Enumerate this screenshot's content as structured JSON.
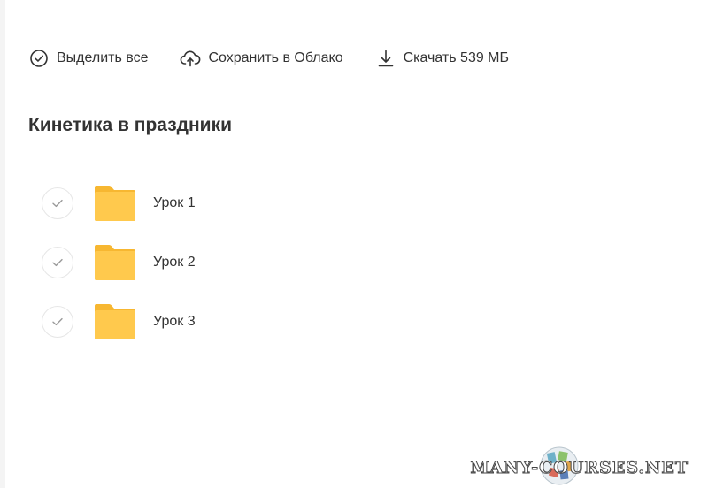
{
  "toolbar": {
    "select_all_label": "Выделить все",
    "save_label": "Сохранить в Облако",
    "download_label": "Скачать 539 МБ"
  },
  "folder": {
    "title": "Кинетика в праздники",
    "items": [
      {
        "name": "Урок 1"
      },
      {
        "name": "Урок 2"
      },
      {
        "name": "Урок 3"
      }
    ]
  },
  "watermark": {
    "text": "MANY-COURSES.NET"
  },
  "colors": {
    "folder": "#ffc94d",
    "folder_tab": "#f7b731",
    "text": "#333333",
    "check_border": "#e6e6e6",
    "check_mark": "#9a9a9a"
  },
  "icons": {
    "select_all": "check-circle-icon",
    "save": "cloud-upload-icon",
    "download": "download-icon",
    "item_check": "check-icon",
    "item_type": "folder-icon"
  }
}
